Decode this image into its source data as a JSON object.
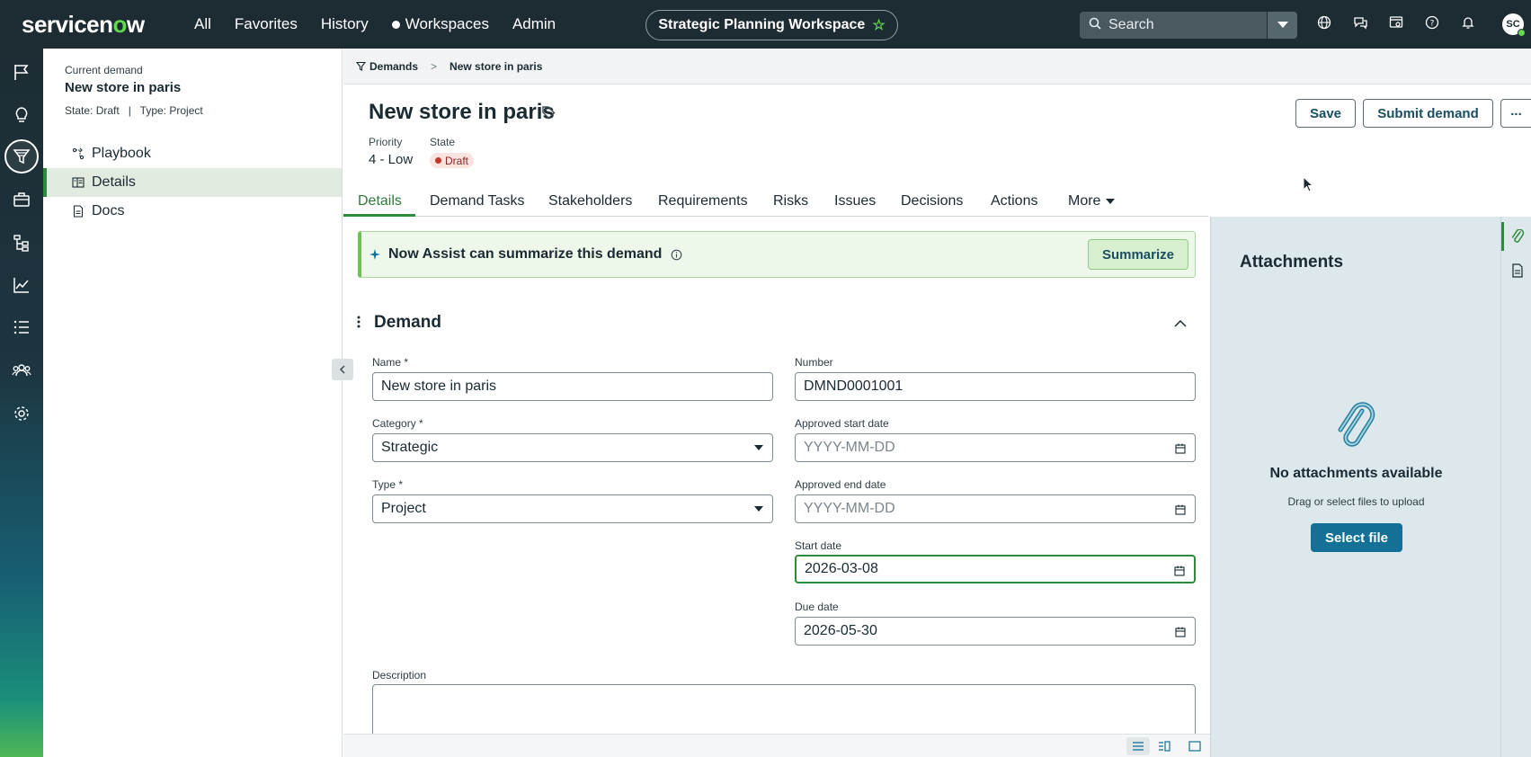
{
  "topbar": {
    "logo_text_pre": "servicen",
    "logo_text_o": "o",
    "logo_text_post": "w",
    "nav": [
      "All",
      "Favorites",
      "History",
      "Workspaces",
      "Admin"
    ],
    "workspace_label": "Strategic Planning Workspace",
    "search_placeholder": "Search",
    "avatar_initials": "SC"
  },
  "left_panel": {
    "current_label": "Current demand",
    "current_title": "New store in paris",
    "meta_state_label": "State:",
    "meta_state_value": "Draft",
    "meta_separator": "|",
    "meta_type_label": "Type:",
    "meta_type_value": "Project",
    "items": [
      {
        "label": "Playbook",
        "icon": "playbook-icon"
      },
      {
        "label": "Details",
        "icon": "details-icon",
        "active": true
      },
      {
        "label": "Docs",
        "icon": "docs-icon"
      }
    ]
  },
  "breadcrumb": {
    "parent": "Demands",
    "separator": ">",
    "current": "New store in paris"
  },
  "record": {
    "title": "New store in paris",
    "priority_label": "Priority",
    "priority_value": "4 - Low",
    "state_label": "State",
    "state_value": "Draft",
    "save_label": "Save",
    "submit_label": "Submit demand",
    "more_actions_label": "..."
  },
  "tabs": [
    "Details",
    "Demand Tasks",
    "Stakeholders",
    "Requirements",
    "Risks",
    "Issues",
    "Decisions",
    "Actions",
    "More"
  ],
  "assist": {
    "text": "Now Assist can summarize this demand",
    "button": "Summarize"
  },
  "form": {
    "section_title": "Demand",
    "required_mark": "*",
    "name_label": "Name",
    "name_value": "New store in paris",
    "number_label": "Number",
    "number_value": "DMND0001001",
    "category_label": "Category",
    "category_value": "Strategic",
    "type_label": "Type",
    "type_value": "Project",
    "approved_start_label": "Approved start date",
    "approved_start_placeholder": "YYYY-MM-DD",
    "approved_end_label": "Approved end date",
    "approved_end_placeholder": "YYYY-MM-DD",
    "start_label": "Start date",
    "start_value": "2026-03-08",
    "due_label": "Due date",
    "due_value": "2026-05-30",
    "description_label": "Description",
    "description_value": ""
  },
  "attachments": {
    "title": "Attachments",
    "empty_title": "No attachments available",
    "empty_sub": "Drag or select files to upload",
    "select_button": "Select file"
  },
  "colors": {
    "topbar": "#1d2c33",
    "accent_green": "#2f8b3c",
    "primary_button": "#137197",
    "attachments_bg": "#dce8ec"
  }
}
